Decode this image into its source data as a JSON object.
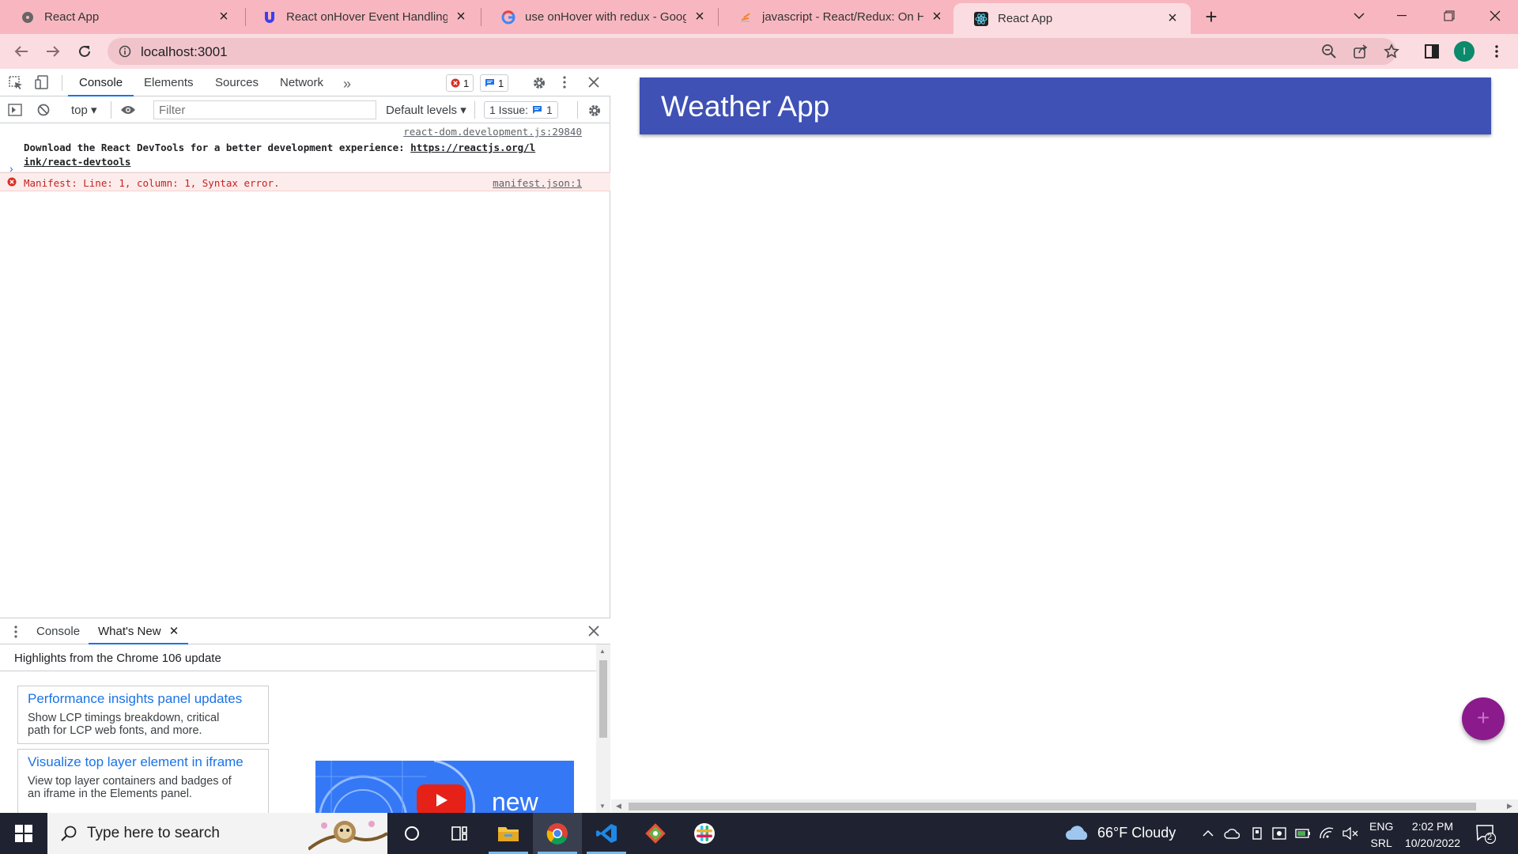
{
  "browser": {
    "tabs": [
      {
        "title": "React App",
        "favicon": "react-icon"
      },
      {
        "title": "React onHover Event Handling (w",
        "favicon": "u-logo-icon"
      },
      {
        "title": "use onHover with redux - Google",
        "favicon": "google-icon"
      },
      {
        "title": "javascript - React/Redux: On Hov",
        "favicon": "stackoverflow-icon"
      },
      {
        "title": "React App",
        "favicon": "react-icon"
      }
    ],
    "url": "localhost:3001",
    "profile_initial": "I",
    "colors": {
      "tabstrip": "#f8b7c0",
      "toolbar": "#fbdde1"
    }
  },
  "devtools": {
    "tabs": [
      "Console",
      "Elements",
      "Sources",
      "Network"
    ],
    "error_count": "1",
    "message_count": "1",
    "context": "top",
    "filter_placeholder": "Filter",
    "levels": "Default levels",
    "issues_label": "1 Issue:",
    "issues_count": "1",
    "messages": [
      {
        "level": "log",
        "source": "react-dom.development.js:29840",
        "text": "Download the React DevTools for a better development experience: ",
        "link": "https://reactjs.org/link/react-devtools",
        "link_line1": "https://reactjs.org/l",
        "link_line2": "ink/react-devtools"
      },
      {
        "level": "error",
        "source": "manifest.json:1",
        "text": "Manifest: Line: 1, column: 1, Syntax error."
      }
    ],
    "drawer": {
      "tabs": [
        "Console",
        "What's New"
      ],
      "subtitle": "Highlights from the Chrome 106 update",
      "cards": [
        {
          "title": "Performance insights panel updates",
          "desc_line1": "Show LCP timings breakdown, critical",
          "desc_line2": "path for LCP web fonts, and more."
        },
        {
          "title": "Visualize top layer element in iframe",
          "desc_line1": "View top layer containers and badges of",
          "desc_line2": "an iframe in the Elements panel."
        }
      ],
      "video_text": "new"
    }
  },
  "page": {
    "app_title": "Weather App",
    "fab_label": "+",
    "colors": {
      "app_bar": "#3f51b5",
      "fab": "#8b1a8c"
    }
  },
  "taskbar": {
    "search_placeholder": "Type here to search",
    "weather": "66°F  Cloudy",
    "lang_line1": "ENG",
    "lang_line2": "SRL",
    "time": "2:02 PM",
    "date": "10/20/2022",
    "notification_count": "2"
  }
}
